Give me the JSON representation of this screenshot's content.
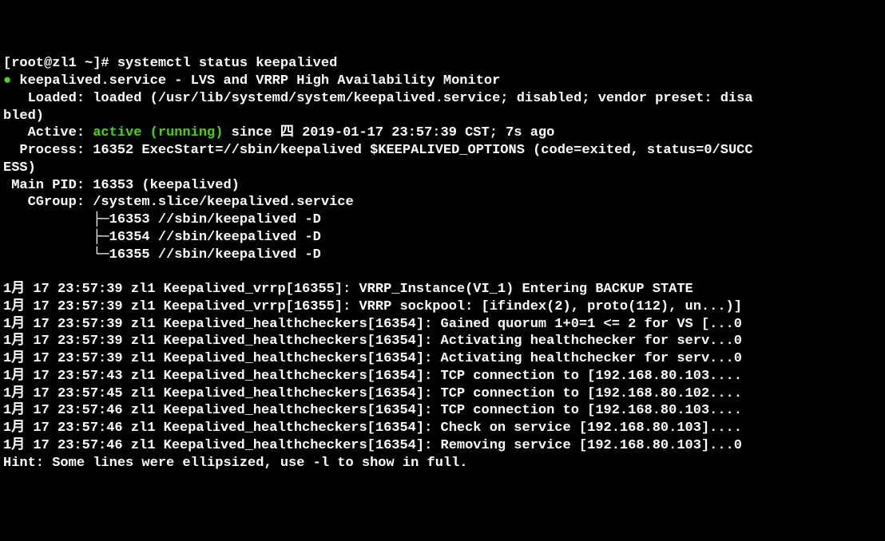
{
  "prompt": "[root@zl1 ~]# ",
  "command": "systemctl status keepalived",
  "dot": "●",
  "service_line": " keepalived.service - LVS and VRRP High Availability Monitor",
  "loaded": "   Loaded: loaded (/usr/lib/systemd/system/keepalived.service; disabled; vendor preset: disa\nbled)",
  "active_label": "   Active: ",
  "active_value": "active (running)",
  "active_since": " since 四 2019-01-17 23:57:39 CST; 7s ago",
  "process": "  Process: 16352 ExecStart=//sbin/keepalived $KEEPALIVED_OPTIONS (code=exited, status=0/SUCC\nESS)",
  "main_pid": " Main PID: 16353 (keepalived)",
  "cgroup_header": "   CGroup: /system.slice/keepalived.service",
  "cgroup_lines": [
    "           ├─16353 //sbin/keepalived -D",
    "           ├─16354 //sbin/keepalived -D",
    "           └─16355 //sbin/keepalived -D"
  ],
  "blank": "",
  "log_lines": [
    "1月 17 23:57:39 zl1 Keepalived_vrrp[16355]: VRRP_Instance(VI_1) Entering BACKUP STATE",
    "1月 17 23:57:39 zl1 Keepalived_vrrp[16355]: VRRP sockpool: [ifindex(2), proto(112), un...)]",
    "1月 17 23:57:39 zl1 Keepalived_healthcheckers[16354]: Gained quorum 1+0=1 <= 2 for VS [...0",
    "1月 17 23:57:39 zl1 Keepalived_healthcheckers[16354]: Activating healthchecker for serv...0",
    "1月 17 23:57:39 zl1 Keepalived_healthcheckers[16354]: Activating healthchecker for serv...0",
    "1月 17 23:57:43 zl1 Keepalived_healthcheckers[16354]: TCP connection to [192.168.80.103....",
    "1月 17 23:57:45 zl1 Keepalived_healthcheckers[16354]: TCP connection to [192.168.80.102....",
    "1月 17 23:57:46 zl1 Keepalived_healthcheckers[16354]: TCP connection to [192.168.80.103....",
    "1月 17 23:57:46 zl1 Keepalived_healthcheckers[16354]: Check on service [192.168.80.103]....",
    "1月 17 23:57:46 zl1 Keepalived_healthcheckers[16354]: Removing service [192.168.80.103]...0"
  ],
  "hint": "Hint: Some lines were ellipsized, use -l to show in full."
}
